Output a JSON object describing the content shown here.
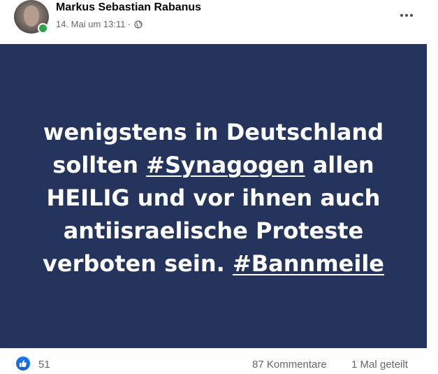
{
  "post": {
    "author": "Markus Sebastian Rabanus",
    "date": "14. Mai um 13:11",
    "separator": "·",
    "audience_icon": "globe-icon",
    "more_icon": "more-options-icon"
  },
  "image_text": {
    "line1": "wenigstens in Deutschland",
    "line2_pre": "sollten ",
    "line2_tag": "#Synagogen",
    "line2_post": " allen",
    "line3": "HEILIG und vor ihnen auch",
    "line4": "antiisraelische Proteste",
    "line5_pre": "verboten sein. ",
    "line5_tag": "#Bannmeile"
  },
  "reactions": {
    "icon": "like-icon",
    "count": "51",
    "comments": "87 Kommentare",
    "shares": "1 Mal geteilt"
  },
  "colors": {
    "panel_background": "#24345d",
    "like_blue": "#1877f2",
    "online_green": "#31a24c",
    "meta_gray": "#65676b"
  }
}
